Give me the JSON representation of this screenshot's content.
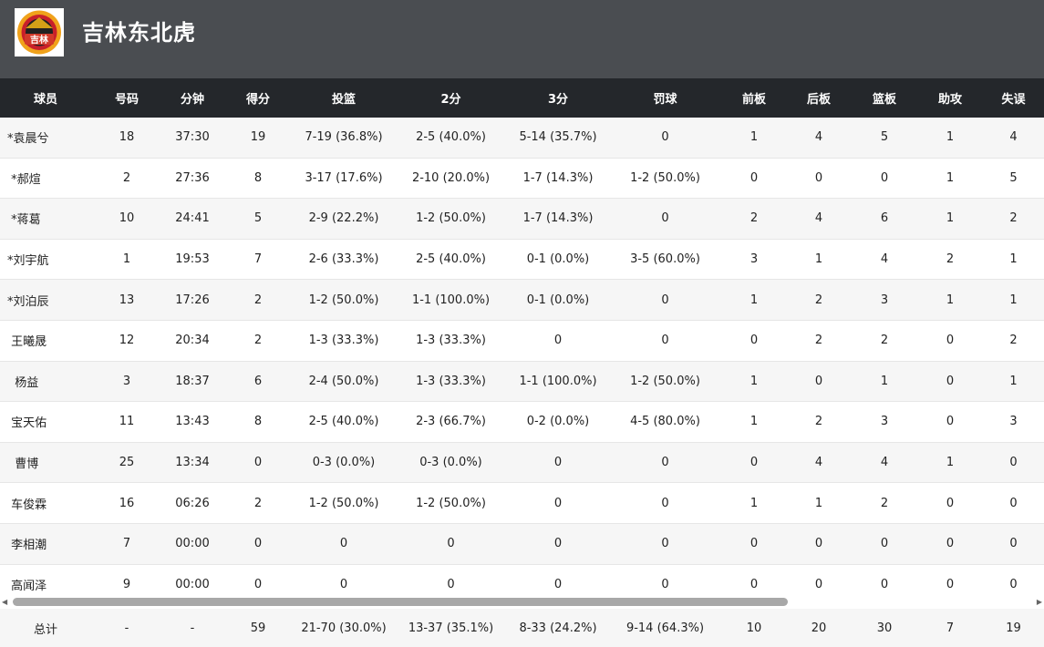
{
  "team": {
    "name": "吉林东北虎",
    "logo_text": "吉林"
  },
  "columns": [
    "球员",
    "号码",
    "分钟",
    "得分",
    "投篮",
    "2分",
    "3分",
    "罚球",
    "前板",
    "后板",
    "篮板",
    "助攻",
    "失误"
  ],
  "players": [
    [
      "*袁晨兮",
      "18",
      "37:30",
      "19",
      "7-19 (36.8%)",
      "2-5 (40.0%)",
      "5-14 (35.7%)",
      "0",
      "1",
      "4",
      "5",
      "1",
      "4"
    ],
    [
      " *郝煊",
      "2",
      "27:36",
      "8",
      "3-17 (17.6%)",
      "2-10 (20.0%)",
      "1-7 (14.3%)",
      "1-2 (50.0%)",
      "0",
      "0",
      "0",
      "1",
      "5"
    ],
    [
      " *蒋葛",
      "10",
      "24:41",
      "5",
      "2-9 (22.2%)",
      "1-2 (50.0%)",
      "1-7 (14.3%)",
      "0",
      "2",
      "4",
      "6",
      "1",
      "2"
    ],
    [
      "*刘宇航",
      "1",
      "19:53",
      "7",
      "2-6 (33.3%)",
      "2-5 (40.0%)",
      "0-1 (0.0%)",
      "3-5 (60.0%)",
      "3",
      "1",
      "4",
      "2",
      "1"
    ],
    [
      "*刘泊辰",
      "13",
      "17:26",
      "2",
      "1-2 (50.0%)",
      "1-1 (100.0%)",
      "0-1 (0.0%)",
      "0",
      "1",
      "2",
      "3",
      "1",
      "1"
    ],
    [
      " 王曦晟",
      "12",
      "20:34",
      "2",
      "1-3 (33.3%)",
      "1-3 (33.3%)",
      "0",
      "0",
      "0",
      "2",
      "2",
      "0",
      "2"
    ],
    [
      "  杨益",
      "3",
      "18:37",
      "6",
      "2-4 (50.0%)",
      "1-3 (33.3%)",
      "1-1 (100.0%)",
      "1-2 (50.0%)",
      "1",
      "0",
      "1",
      "0",
      "1"
    ],
    [
      " 宝天佑",
      "11",
      "13:43",
      "8",
      "2-5 (40.0%)",
      "2-3 (66.7%)",
      "0-2 (0.0%)",
      "4-5 (80.0%)",
      "1",
      "2",
      "3",
      "0",
      "3"
    ],
    [
      "  曹博",
      "25",
      "13:34",
      "0",
      "0-3 (0.0%)",
      "0-3 (0.0%)",
      "0",
      "0",
      "0",
      "4",
      "4",
      "1",
      "0"
    ],
    [
      " 车俊霖",
      "16",
      "06:26",
      "2",
      "1-2 (50.0%)",
      "1-2 (50.0%)",
      "0",
      "0",
      "1",
      "1",
      "2",
      "0",
      "0"
    ],
    [
      " 李相潮",
      "7",
      "00:00",
      "0",
      "0",
      "0",
      "0",
      "0",
      "0",
      "0",
      "0",
      "0",
      "0"
    ],
    [
      " 高闻泽",
      "9",
      "00:00",
      "0",
      "0",
      "0",
      "0",
      "0",
      "0",
      "0",
      "0",
      "0",
      "0"
    ]
  ],
  "totals": [
    "总计",
    "-",
    "-",
    "59",
    "21-70 (30.0%)",
    "13-37 (35.1%)",
    "8-33 (24.2%)",
    "9-14 (64.3%)",
    "10",
    "20",
    "30",
    "7",
    "19"
  ],
  "colors": {
    "header_bg": "#4a4d51",
    "table_header_bg": "#24272b",
    "stripe": "#f6f6f6"
  }
}
